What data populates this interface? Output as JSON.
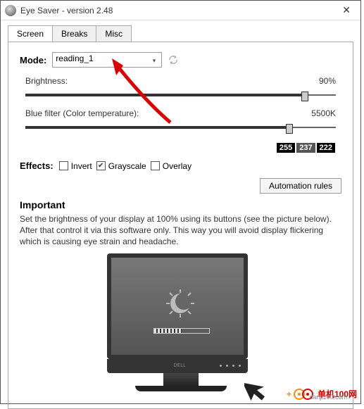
{
  "titlebar": {
    "title": "Eye Saver - version 2.48"
  },
  "tabs": {
    "screen": "Screen",
    "breaks": "Breaks",
    "misc": "Misc",
    "active": "screen"
  },
  "mode": {
    "label": "Mode:",
    "value": "reading_1"
  },
  "brightness": {
    "label": "Brightness:",
    "value": "90%",
    "pct": 90
  },
  "bluefilter": {
    "label": "Blue filter (Color temperature):",
    "value": "5500K",
    "pct": 85
  },
  "rgb": {
    "r": "255",
    "g": "237",
    "b": "222"
  },
  "effects": {
    "label": "Effects:",
    "invert": {
      "label": "Invert",
      "checked": false
    },
    "grayscale": {
      "label": "Grayscale",
      "checked": true
    },
    "overlay": {
      "label": "Overlay",
      "checked": false
    }
  },
  "automation_btn": "Automation rules",
  "important_heading": "Important",
  "important_text": "Set the brightness of your display at 100% using its buttons (see the picture below). After that control it via this software only. This way you will avoid display flickering which is causing eye strain and headache.",
  "watermark": {
    "cn": "单机100网",
    "domain": "danji100.com"
  }
}
